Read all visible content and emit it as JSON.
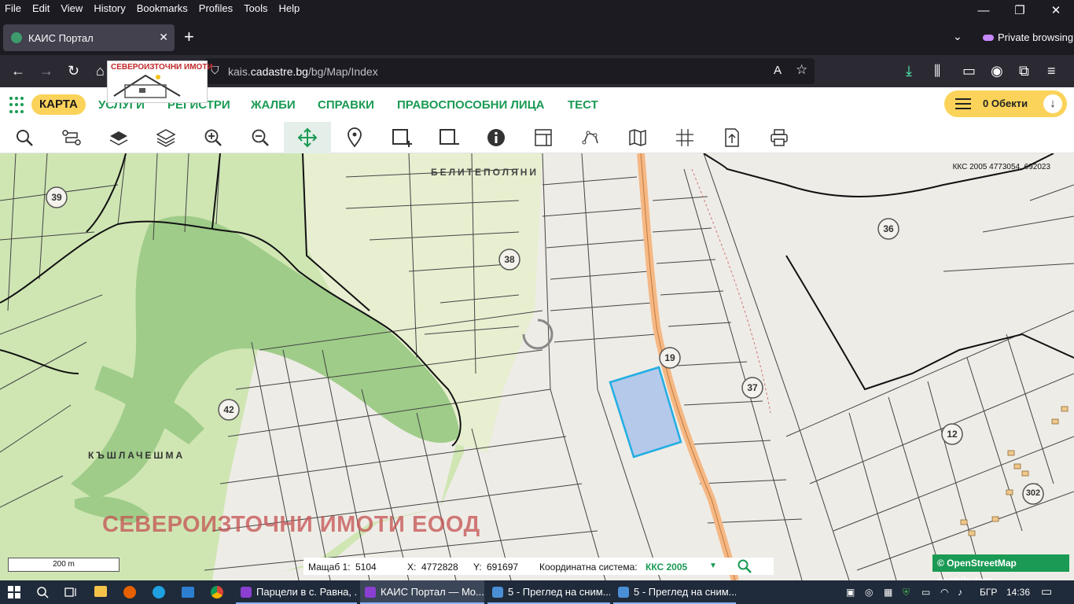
{
  "menu": [
    "File",
    "Edit",
    "View",
    "History",
    "Bookmarks",
    "Profiles",
    "Tools",
    "Help"
  ],
  "window_controls": {
    "minimize": "—",
    "restore": "❐",
    "close": "✕"
  },
  "tab": {
    "title": "КАИС Портал",
    "close": "✕"
  },
  "private_label": "Private browsing",
  "url": {
    "prefix": "kais.",
    "domain": "cadastre.bg",
    "path": "/bg/Map/Index"
  },
  "logo_text": "СЕВЕРОИЗТОЧНИ ИМОТИ",
  "nav": {
    "active": "КАРТА",
    "items": [
      "УСЛУГИ",
      "РЕГИСТРИ",
      "ЖАЛБИ",
      "СПРАВКИ",
      "ПРАВОСПОСОБНИ ЛИЦА",
      "ТЕСТ"
    ]
  },
  "objects_button": {
    "label": "0 Обекти",
    "arrow": "↓"
  },
  "tools": [
    "search",
    "route",
    "layers-single",
    "layers",
    "zoom-in",
    "zoom-out",
    "pan",
    "marker",
    "select-add",
    "select-remove",
    "info",
    "measure",
    "polyline",
    "map",
    "grid",
    "export",
    "print"
  ],
  "map": {
    "coords_top": "ККС 2005 4773054, 692023",
    "places": [
      "БЕЛИТЕПОЛЯНИ",
      "КЪШЛАЧЕШМА"
    ],
    "zones": [
      "39",
      "38",
      "36",
      "19",
      "37",
      "42",
      "12",
      "302"
    ],
    "watermark": "СЕВЕРОИЗТОЧНИ ИМОТИ ЕООД",
    "scale": "200 m"
  },
  "status": {
    "scale_label": "Мащаб 1:",
    "scale_value": "5104",
    "x_label": "X:",
    "x_value": "4772828",
    "y_label": "Y:",
    "y_value": "691697",
    "crs_label": "Координатна система:",
    "crs_value": "ККС 2005",
    "crs_arrow": "▼"
  },
  "attribution": "© OpenStreetMap contributors.",
  "taskbar": {
    "apps": [
      "Парцели в с. Равна, ...",
      "КАИС Портал — Mo...",
      "5 - Преглед на сним...",
      "5 - Преглед на сним..."
    ],
    "lang": "БГР",
    "time": "14:36"
  },
  "colors": {
    "accent": "#1a9a54",
    "highlight": "#fbd35a",
    "selected_parcel": "#b5c9ea"
  }
}
